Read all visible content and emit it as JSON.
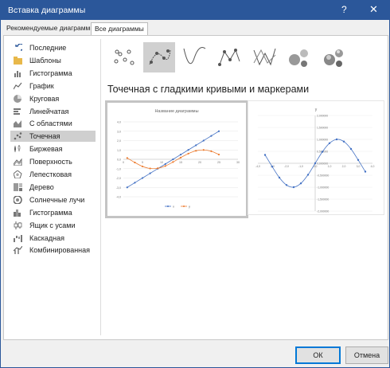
{
  "window": {
    "title": "Вставка диаграммы",
    "help": "?",
    "close": "✕"
  },
  "tabs": [
    {
      "label": "Рекомендуемые диаграммы"
    },
    {
      "label": "Все диаграммы"
    }
  ],
  "categories": [
    {
      "label": "Последние",
      "icon": "undo-arrow-icon"
    },
    {
      "label": "Шаблоны",
      "icon": "folder-icon"
    },
    {
      "label": "Гистограмма",
      "icon": "column-chart-icon"
    },
    {
      "label": "График",
      "icon": "line-chart-icon"
    },
    {
      "label": "Круговая",
      "icon": "pie-chart-icon"
    },
    {
      "label": "Линейчатая",
      "icon": "bar-chart-icon"
    },
    {
      "label": "С областями",
      "icon": "area-chart-icon"
    },
    {
      "label": "Точечная",
      "icon": "scatter-chart-icon"
    },
    {
      "label": "Биржевая",
      "icon": "stock-chart-icon"
    },
    {
      "label": "Поверхность",
      "icon": "surface-chart-icon"
    },
    {
      "label": "Лепестковая",
      "icon": "radar-chart-icon"
    },
    {
      "label": "Дерево",
      "icon": "treemap-icon"
    },
    {
      "label": "Солнечные лучи",
      "icon": "sunburst-icon"
    },
    {
      "label": "Гистограмма",
      "icon": "histogram-icon"
    },
    {
      "label": "Ящик с усами",
      "icon": "box-whisker-icon"
    },
    {
      "label": "Каскадная",
      "icon": "waterfall-icon"
    },
    {
      "label": "Комбинированная",
      "icon": "combo-chart-icon"
    }
  ],
  "selected_category": "Точечная",
  "subtype_heading": "Точечная с гладкими кривыми и маркерами",
  "buttons": {
    "ok": "ОК",
    "cancel": "Отмена"
  },
  "colors": {
    "accent": "#2b579a",
    "series_blue": "#4472c4",
    "series_orange": "#ed7d31"
  },
  "chart_data": [
    {
      "type": "scatter",
      "title": "Название диаграммы",
      "xlabel": "",
      "ylabel": "",
      "xlim": [
        0,
        30
      ],
      "ylim": [
        -4,
        4
      ],
      "x_ticks": [
        "0",
        "5",
        "10",
        "15",
        "20",
        "25",
        "30"
      ],
      "y_ticks": [
        "4,0",
        "3,0",
        "2,0",
        "1,0",
        "0,0",
        "-1,0",
        "-2,0",
        "-3,0",
        "-4,0"
      ],
      "legend": [
        "x",
        "y"
      ],
      "legend_position": "bottom",
      "series": [
        {
          "name": "x",
          "color": "#4472c4",
          "x": [
            1,
            3,
            5,
            7,
            9,
            11,
            13,
            15,
            17,
            19,
            21,
            23,
            25
          ],
          "y": [
            -3.0,
            -2.5,
            -2.0,
            -1.5,
            -1.0,
            -0.5,
            0.0,
            0.5,
            1.0,
            1.5,
            2.0,
            2.5,
            3.0
          ]
        },
        {
          "name": "y",
          "color": "#ed7d31",
          "x": [
            1,
            3,
            5,
            7,
            9,
            11,
            13,
            15,
            17,
            19,
            21,
            23,
            25
          ],
          "y": [
            0.14,
            -0.34,
            -0.76,
            -0.98,
            -0.96,
            -0.71,
            -0.29,
            0.18,
            0.61,
            0.91,
            1.0,
            0.86,
            0.51
          ]
        }
      ]
    },
    {
      "type": "scatter",
      "title": "y",
      "xlim": [
        -4,
        4
      ],
      "ylim": [
        -2,
        2
      ],
      "x_ticks": [
        "-4,0",
        "-3,0",
        "-2,0",
        "-1,0",
        "0,0",
        "1,0",
        "2,0",
        "3,0",
        "4,0"
      ],
      "y_ticks": [
        "2,000000",
        "1,500000",
        "1,000000",
        "0,500000",
        "0,000000",
        "-0,500000",
        "-1,000000",
        "-1,500000",
        "-2,000000"
      ],
      "series": [
        {
          "name": "y",
          "color": "#4472c4",
          "x": [
            -3.5,
            -3,
            -2.5,
            -2,
            -1.5,
            -1,
            -0.5,
            0,
            0.5,
            1,
            1.5,
            2,
            2.5,
            3,
            3.5
          ],
          "y": [
            0.35,
            -0.14,
            -0.6,
            -0.91,
            -1.0,
            -0.84,
            -0.48,
            0,
            0.48,
            0.84,
            1.0,
            0.91,
            0.6,
            0.14,
            -0.35
          ]
        }
      ]
    }
  ]
}
